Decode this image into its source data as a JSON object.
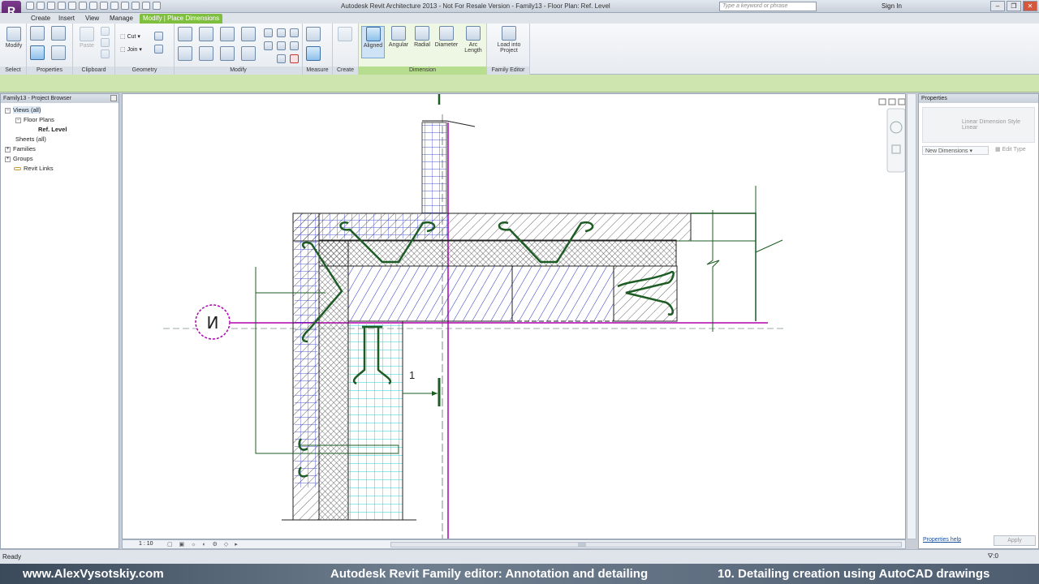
{
  "titlebar": {
    "title": "Autodesk Revit Architecture 2013 -  Not For Resale Version -     Family13 - Floor Plan: Ref. Level",
    "search_placeholder": "Type a keyword or phrase",
    "signin": "Sign In"
  },
  "tabs": [
    {
      "label": "Create"
    },
    {
      "label": "Insert"
    },
    {
      "label": "View"
    },
    {
      "label": "Manage"
    },
    {
      "label": "Modify | Place Dimensions"
    }
  ],
  "ribbon": {
    "select": {
      "label": "Select",
      "modify": "Modify"
    },
    "properties": {
      "label": "Properties"
    },
    "clipboard": {
      "label": "Clipboard",
      "paste": "Paste"
    },
    "geometry": {
      "label": "Geometry",
      "cut": "Cut",
      "join": "Join"
    },
    "modify_panel": {
      "label": "Modify"
    },
    "measure": {
      "label": "Measure"
    },
    "create": {
      "label": "Create"
    },
    "dimension": {
      "label": "Dimension",
      "aligned": "Aligned",
      "angular": "Angular",
      "radial": "Radial",
      "diameter": "Diameter",
      "arc_line1": "Arc",
      "arc_line2": "Length"
    },
    "family_editor": {
      "label": "Family Editor",
      "load_line1": "Load into",
      "load_line2": "Project"
    }
  },
  "browser": {
    "title": "Family13 - Project Browser",
    "items": [
      {
        "label": "Views (all)"
      },
      {
        "label": "Floor Plans"
      },
      {
        "label": "Ref. Level"
      },
      {
        "label": "Sheets (all)"
      },
      {
        "label": "Families"
      },
      {
        "label": "Groups"
      },
      {
        "label": "Revit Links"
      }
    ]
  },
  "drawing": {
    "grid_bubble": "И",
    "dim_label": "1"
  },
  "view_control": {
    "scale": "1 : 10"
  },
  "properties": {
    "title": "Properties",
    "type_name": "Linear Dimension Style Linear",
    "filter": "New Dimensions",
    "edit_type": "Edit Type",
    "help": "Properties help",
    "apply": "Apply"
  },
  "status": {
    "text": "Ready",
    "filter_count": ":0"
  },
  "caption": {
    "site": "www.AlexVysotskiy.com",
    "course": "Autodesk Revit Family editor: Annotation and detailing",
    "lesson": "10. Detailing creation using AutoCAD drawings"
  },
  "colors": {
    "ribbon_active": "#7fbf3e",
    "grid_line": "#b000b0",
    "detail_green": "#1d5c24",
    "hatch_blue": "#2230c0",
    "hatch_cyan": "#20d0d0"
  }
}
